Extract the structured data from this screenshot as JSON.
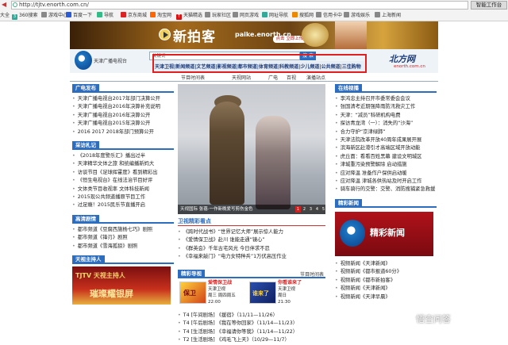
{
  "browser": {
    "url": "http://tjtv.enorth.com.cn/",
    "right_button": "智能工作台",
    "bookmarks": [
      "大全",
      "360搜索",
      "游戏中心",
      "百度一下",
      "导航",
      "京东商城",
      "淘宝网",
      "天猫精选",
      "玩家社区",
      "网页游戏",
      "网址导航",
      "搜狐网",
      "信用卡中",
      "游戏娱乐",
      "上海新闻"
    ]
  },
  "banner": {
    "title": "新拍客",
    "url": "paike.enorth.cn",
    "live_button": "点击 立即上传"
  },
  "header": {
    "logo_text": "天津广播电视台",
    "search_placeholder": "关键词",
    "search_button": "搜 索",
    "channels": "天津卫视|新闻频道|文艺频道|影视频道|都市频道|体育频道|科教频道|少儿频道|公共频道|三佳购物",
    "enorth_logo": "北方网",
    "enorth_url": "enorth.com.cn"
  },
  "nav": [
    "节目时间表",
    "天视网站",
    "广电",
    "百视",
    "演播站点"
  ],
  "left": {
    "guangdian_title": "广电发布",
    "guangdian_items": [
      "天津广播电视台2017年部门决算公开",
      "天津广播电视台2016年决算补充说明",
      "天津广播电视台2016年决算公开",
      "天津广播电视台2015年决算公开",
      "2016  2017  2018年部门预算公开"
    ],
    "caifang_title": "采访札记",
    "caifang_items": [
      "《2018年度警乐汇》播出过半",
      "天津精华文体之旅  和统编播新妈大",
      "访谈节目《足球挥霍度》看到精彩出",
      "《恒生电视台》在线法治节目好评",
      "文体类节目收视率  文体科技新闻",
      "2015现公共频道播原节目工作",
      "过足瘾！2015民乐节直播开启"
    ],
    "gaoqing_title": "高清剧情",
    "gaoqing_items": [
      "都市频道《豆腐西施杨七巧》剧照",
      "都市频道《锋刃》剧照",
      "都市频道《雪海孤狼》剧照"
    ],
    "host_title": "天视主持人",
    "host_banner": "TJTV 天视主持人",
    "host_slogan": "璀璨耀银屏"
  },
  "center": {
    "caption": "天视国际 张蓓·一作新晚爱写剪伤金色",
    "pages": [
      "1",
      "2",
      "3",
      "4",
      "5"
    ],
    "kandian_title": "卫视精彩看点",
    "kandian_items": [
      "《跨时代战书》“世界记忆大师”展示惊人能力",
      "《爱情保卫战》赴川 谁能走通“镜心”",
      "《群英会》千年古宅风光 今日伴求不忍",
      "《幸福来敲门》“电力女特种兵”1万伏高压作业"
    ],
    "daoshi_title": "精彩导视",
    "schedule_title": "节目时间表",
    "show1_name": "爱情保卫战",
    "show1_channel": "天津卫视",
    "show1_days": "周三 周四周五",
    "show1_time": "22:00",
    "show2_name": "你看谁来了",
    "show2_channel": "天津卫视",
    "show2_days": "周日",
    "show2_time": "21:30",
    "tv_items": [
      "T4 [午间剧场] 《援宿》（11/11—11/26）",
      "T4 [午后剧场] 《我在等你回家》（11/14—11/23）",
      "T4 [生活剧场] 《幸福请你等我》（11/14—11/22）",
      "T2 [生活剧场] 《鸡毛飞上天》（10/29—11/7）"
    ]
  },
  "right": {
    "zaixian_title": "在线视播",
    "zaixian_items": [
      "李鸿忠主持召开市委常委会会议",
      "张国清考近期强降雨防汛救灾工作",
      "天津：“减员”科研机构电费",
      "探访青龙湾（一）：消失的“沙海”",
      "合力守护“京津绿肺”",
      "天津法院改革开放40周年成果展开展",
      "滨海新区赴港引才高端区域开放动能",
      "虎丘面：看看百姓黑幕  建设文明城区",
      "津城重污染预警解除  启动措施",
      "应对降温  准备作户保供启动暖",
      "应对降温  津城各供热站及时开启工作",
      "骑车骑行的交警：交警、消防搜捕紧急救援"
    ],
    "jingcai_title": "精彩新闻",
    "jingcai_label": "精彩新闻",
    "video_items": [
      "视频新闻《天津新闻》",
      "视频新闻《都市报道60分》",
      "视频新闻《都市新拍客》",
      "视频新闻《天津新闻》",
      "视频新闻《天津早晨》"
    ],
    "video_prefix": [
      "视频新闻",
      "视频新闻",
      "视频新闻",
      "广播新闻",
      "广播新闻"
    ]
  },
  "watermark": "悟空问答"
}
